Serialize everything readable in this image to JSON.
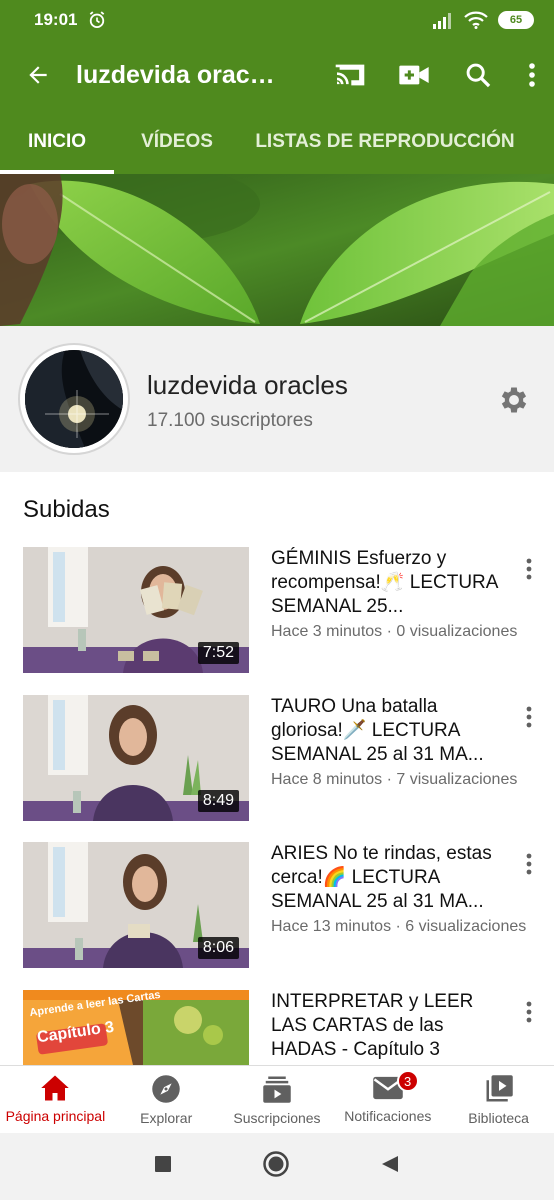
{
  "status": {
    "time": "19:01",
    "battery": "65"
  },
  "appbar": {
    "title": "luzdevida oracles"
  },
  "tabs": [
    {
      "label": "INICIO"
    },
    {
      "label": "VÍDEOS"
    },
    {
      "label": "LISTAS DE REPRODUCCIÓN"
    }
  ],
  "channel": {
    "name": "luzdevida oracles",
    "subscribers": "17.100 suscriptores"
  },
  "section": {
    "title": "Subidas"
  },
  "videos": [
    {
      "title": "GÉMINIS Esfuerzo y recompensa!🥂 LECTURA SEMANAL 25...",
      "meta": "Hace 3 minutos · 0 visualizaciones",
      "duration": "7:52"
    },
    {
      "title": "TAURO Una batalla gloriosa!🗡️ LECTURA SEMANAL 25 al 31 MA...",
      "meta": "Hace 8 minutos · 7 visualizaciones",
      "duration": "8:49"
    },
    {
      "title": "ARIES No te rindas, estas cerca!🌈 LECTURA SEMANAL 25 al 31 MA...",
      "meta": "Hace 13 minutos · 6 visualizaciones",
      "duration": "8:06"
    },
    {
      "title": "INTERPRETAR y LEER LAS CARTAS de las HADAS - Capítulo 3",
      "meta": "",
      "duration": "",
      "thumb_text_1": "Aprende a leer las Cartas",
      "thumb_text_2": "Capítulo 3"
    }
  ],
  "bottomnav": [
    {
      "label": "Página principal",
      "icon": "home-icon"
    },
    {
      "label": "Explorar",
      "icon": "compass-icon"
    },
    {
      "label": "Suscripciones",
      "icon": "subscriptions-icon"
    },
    {
      "label": "Notificaciones",
      "icon": "mail-icon",
      "badge": "3"
    },
    {
      "label": "Biblioteca",
      "icon": "library-icon"
    }
  ],
  "colors": {
    "brand": "#4f8a1e",
    "accent": "#cc0000"
  }
}
